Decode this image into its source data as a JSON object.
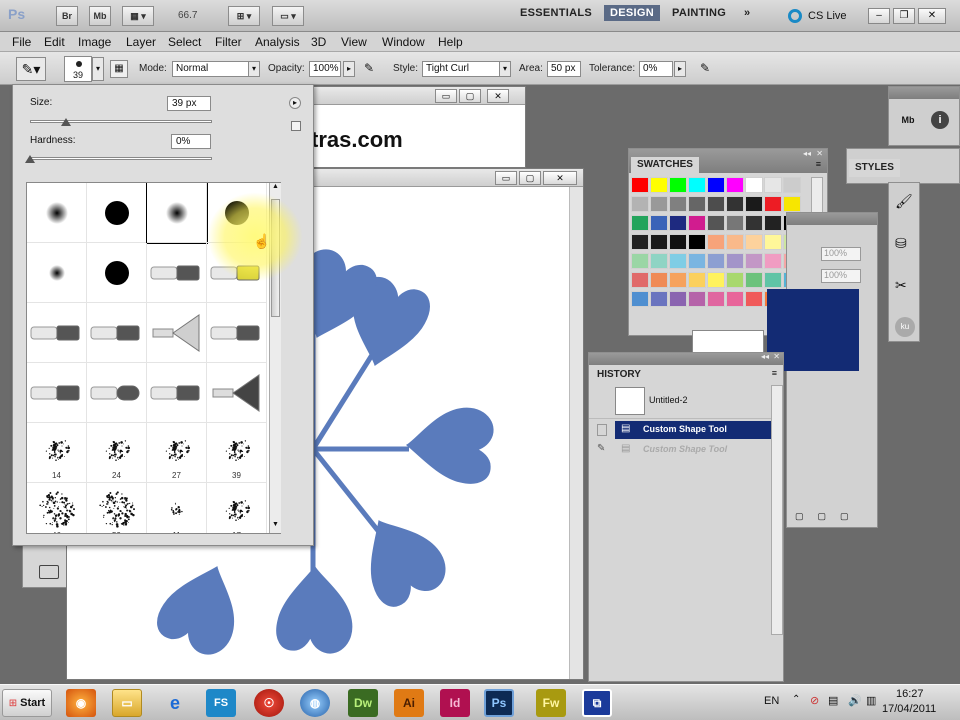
{
  "appbar": {
    "br_label": "Br",
    "mb_label": "Mb",
    "zoom": "66.7",
    "workspaces": [
      "ESSENTIALS",
      "DESIGN",
      "PAINTING"
    ],
    "cs_live": "CS Live"
  },
  "menu": [
    "File",
    "Edit",
    "Image",
    "Layer",
    "Select",
    "Filter",
    "Analysis",
    "3D",
    "View",
    "Window",
    "Help"
  ],
  "options": {
    "brush_size_value": "39",
    "mode_label": "Mode:",
    "mode_value": "Normal",
    "opacity_label": "Opacity:",
    "opacity_value": "100%",
    "style_label": "Style:",
    "style_value": "Tight Curl",
    "area_label": "Area:",
    "area_value": "50 px",
    "tolerance_label": "Tolerance:",
    "tolerance_value": "0%"
  },
  "brush_picker": {
    "size_label": "Size:",
    "size_value": "39 px",
    "size_slider_fraction": 0.2,
    "hardness_label": "Hardness:",
    "hardness_value": "0%",
    "hardness_slider_fraction": 0.0,
    "brushes": [
      {
        "kind": "soft",
        "num": ""
      },
      {
        "kind": "hard",
        "num": ""
      },
      {
        "kind": "soft",
        "num": ""
      },
      {
        "kind": "hard",
        "num": ""
      },
      {
        "kind": "soft-small",
        "num": ""
      },
      {
        "kind": "hard",
        "num": ""
      },
      {
        "kind": "bristle-round",
        "num": ""
      },
      {
        "kind": "bristle-flat-yellow",
        "num": ""
      },
      {
        "kind": "bristle-flat",
        "num": ""
      },
      {
        "kind": "bristle-angle",
        "num": ""
      },
      {
        "kind": "fan",
        "num": ""
      },
      {
        "kind": "bristle-point",
        "num": ""
      },
      {
        "kind": "bristle-blunt",
        "num": ""
      },
      {
        "kind": "bristle-rounded",
        "num": ""
      },
      {
        "kind": "bristle-wedge",
        "num": ""
      },
      {
        "kind": "fan-dark",
        "num": ""
      },
      {
        "kind": "spatter",
        "num": "14"
      },
      {
        "kind": "spatter",
        "num": "24"
      },
      {
        "kind": "spatter",
        "num": "27"
      },
      {
        "kind": "spatter",
        "num": "39"
      },
      {
        "kind": "spatter-large",
        "num": "46"
      },
      {
        "kind": "spatter-large",
        "num": "59"
      },
      {
        "kind": "spatter-small",
        "num": "11"
      },
      {
        "kind": "spatter",
        "num": "17"
      }
    ]
  },
  "doc_back": {
    "text": "tras.com"
  },
  "swatches": {
    "title": "SWATCHES",
    "colors": [
      "#ff0000",
      "#ffff00",
      "#00ff00",
      "#00ffff",
      "#0000ff",
      "#ff00ff",
      "#ffffff",
      "#e6e6e6",
      "#cccccc",
      "#b3b3b3",
      "#999999",
      "#808080",
      "#666666",
      "#4d4d4d",
      "#333333",
      "#1a1a1a",
      "#ed1c24",
      "#f7e600",
      "#23a45c",
      "#3a63b8",
      "#1e2a80",
      "#d11c8f",
      "#555555",
      "#777777",
      "#333333",
      "#222222",
      "#000000",
      "#222222",
      "#1a1a1a",
      "#111111",
      "#000000",
      "#f7a37a",
      "#f9b98a",
      "#fdd29c",
      "#fff799",
      "#cde6a0",
      "#9ad6a5",
      "#8fd4c4",
      "#7fcde5",
      "#7ab5e1",
      "#8c9fd2",
      "#a394c9",
      "#c397c6",
      "#f09cc2",
      "#f6a6a6",
      "#e06a6a",
      "#ef8a55",
      "#f6a25c",
      "#fbd05c",
      "#fff25c",
      "#a8d86d",
      "#6cc27c",
      "#5fc4a6",
      "#55b3d6",
      "#4f8fd0",
      "#6a74bf",
      "#8a64b0",
      "#b563a9",
      "#e066a0",
      "#e8659a",
      "#f05a5a",
      "#f47a3a",
      "#f6a33a"
    ]
  },
  "styles": {
    "title": "STYLES",
    "zoom_a": "100%",
    "zoom_b": "100%"
  },
  "history": {
    "title": "HISTORY",
    "snapshot": "Untitled-2",
    "items": [
      "Custom Shape Tool",
      "Custom Shape Tool"
    ]
  },
  "taskbar": {
    "start": "Start",
    "lang": "EN",
    "time": "16:27",
    "date": "17/04/2011",
    "apps": [
      "Dw",
      "Ai",
      "Id",
      "Ps",
      "Fw"
    ]
  },
  "colors": {
    "shape_blue": "#5a7bbc",
    "history_selected": "#132b74",
    "design_tab": "#5a6a86"
  }
}
